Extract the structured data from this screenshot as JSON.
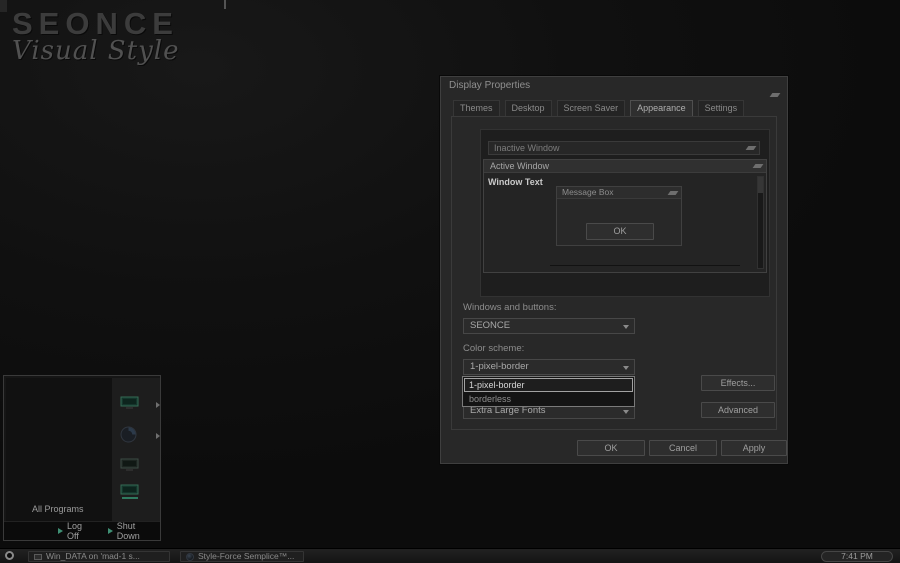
{
  "desktop": {
    "logo_title": "SEONCE",
    "logo_subtitle": "Visual Style"
  },
  "display_properties": {
    "title": "Display Properties",
    "tabs": [
      {
        "label": "Themes"
      },
      {
        "label": "Desktop"
      },
      {
        "label": "Screen Saver"
      },
      {
        "label": "Appearance"
      },
      {
        "label": "Settings"
      }
    ],
    "active_tab": "Appearance",
    "preview": {
      "inactive_window_title": "Inactive Window",
      "active_window_title": "Active Window",
      "window_text": "Window Text",
      "message_box_title": "Message Box",
      "message_box_ok": "OK"
    },
    "fields": {
      "windows_and_buttons_label": "Windows and buttons:",
      "windows_and_buttons_value": "SEONCE",
      "color_scheme_label": "Color scheme:",
      "color_scheme_value": "1-pixel-border",
      "color_scheme_options": [
        {
          "label": "1-pixel-border",
          "selected": true
        },
        {
          "label": "borderless",
          "selected": false
        }
      ],
      "font_size_value": "Extra Large Fonts"
    },
    "buttons": {
      "effects": "Effects...",
      "advanced": "Advanced",
      "ok": "OK",
      "cancel": "Cancel",
      "apply": "Apply"
    }
  },
  "start_menu": {
    "all_programs_label": "All Programs",
    "log_off_label": "Log Off",
    "shut_down_label": "Shut Down"
  },
  "taskbar": {
    "tasks": [
      {
        "label": "Win_DATA on 'mad-1 s..."
      },
      {
        "label": "Style-Force Semplice™..."
      }
    ],
    "clock": "7:41 PM"
  },
  "colors": {
    "accent_green": "#3f8f74",
    "desktop_bg": "#101010"
  }
}
